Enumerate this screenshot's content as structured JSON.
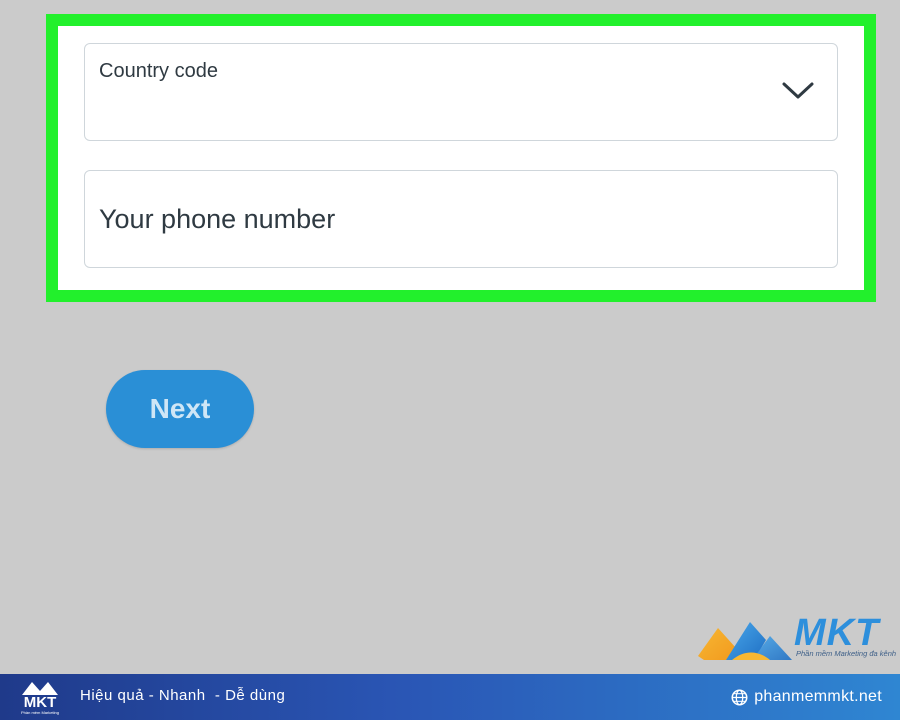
{
  "form": {
    "country_code": {
      "label": "Country code",
      "icon": "chevron-down-icon"
    },
    "phone": {
      "placeholder": "Your phone number",
      "value": ""
    },
    "highlight_color": "#22f02c"
  },
  "actions": {
    "next_label": "Next",
    "next_color": "#2a8fd6"
  },
  "watermark": {
    "brand": "MKT",
    "tagline": "Phần mềm Marketing đa kênh",
    "brand_color": "#2d8fdc"
  },
  "banner": {
    "logo_text": "MKT",
    "logo_sub": "Phần mềm Marketing",
    "slogan": "Hiệu quả - Nhanh  - Dễ dùng",
    "site": "phanmemmkt.net",
    "site_icon": "globe-icon"
  }
}
